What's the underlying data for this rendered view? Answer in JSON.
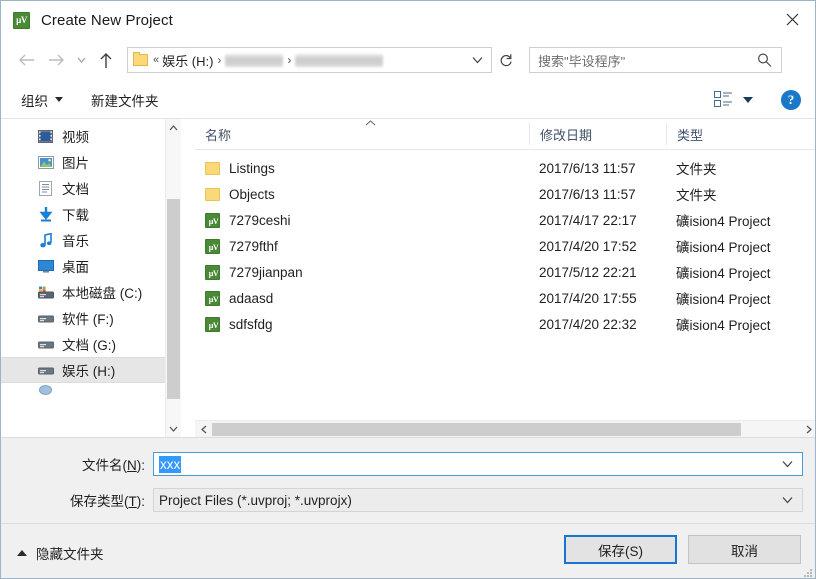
{
  "window": {
    "title": "Create New Project",
    "app_icon": "uvision-icon",
    "close_label": "✕"
  },
  "nav": {
    "back_icon": "arrow-left-icon",
    "forward_icon": "arrow-right-icon",
    "recent_icon": "chevron-down-icon",
    "up_icon": "arrow-up-icon",
    "refresh_icon": "refresh-icon",
    "address": {
      "folder_icon": "folder-icon",
      "overflow": "«",
      "crumbs": [
        {
          "label": "娱乐 (H:)",
          "redacted": false
        },
        {
          "label": "",
          "redacted": true
        },
        {
          "label": "",
          "redacted": true
        }
      ],
      "separator": "›",
      "caret_icon": "chevron-down-icon"
    },
    "search": {
      "placeholder": "搜索\"毕设程序\"",
      "icon": "search-icon"
    }
  },
  "toolbar": {
    "organize_label": "组织",
    "new_folder_label": "新建文件夹",
    "view_icon": "list-view-icon",
    "view_caret_icon": "chevron-down-icon",
    "help_label": "?",
    "help_icon": "help-icon"
  },
  "sidebar": {
    "items": [
      {
        "label": "视频",
        "icon": "videos-icon",
        "selected": false
      },
      {
        "label": "图片",
        "icon": "pictures-icon",
        "selected": false
      },
      {
        "label": "文档",
        "icon": "documents-icon",
        "selected": false
      },
      {
        "label": "下载",
        "icon": "downloads-icon",
        "selected": false
      },
      {
        "label": "音乐",
        "icon": "music-icon",
        "selected": false
      },
      {
        "label": "桌面",
        "icon": "desktop-icon",
        "selected": false
      },
      {
        "label": "本地磁盘 (C:)",
        "icon": "system-drive-icon",
        "selected": false
      },
      {
        "label": "软件 (F:)",
        "icon": "drive-icon",
        "selected": false
      },
      {
        "label": "文档 (G:)",
        "icon": "drive-icon",
        "selected": false
      },
      {
        "label": "娱乐 (H:)",
        "icon": "drive-icon",
        "selected": true
      }
    ],
    "scroll_up_icon": "chevron-up-icon",
    "scroll_down_icon": "chevron-down-icon"
  },
  "filelist": {
    "columns": [
      {
        "key": "name",
        "label": "名称",
        "sorted": "asc"
      },
      {
        "key": "date",
        "label": "修改日期",
        "sorted": ""
      },
      {
        "key": "type",
        "label": "类型",
        "sorted": ""
      }
    ],
    "sort_caret_icon": "sort-ascending-icon",
    "rows": [
      {
        "name": "Listings",
        "date": "2017/6/13 11:57",
        "type": "文件夹",
        "icon": "folder-icon"
      },
      {
        "name": "Objects",
        "date": "2017/6/13 11:57",
        "type": "文件夹",
        "icon": "folder-icon"
      },
      {
        "name": "7279ceshi",
        "date": "2017/4/17 22:17",
        "type": "礦ision4 Project",
        "icon": "uvision-project-icon"
      },
      {
        "name": "7279fthf",
        "date": "2017/4/20 17:52",
        "type": "礦ision4 Project",
        "icon": "uvision-project-icon"
      },
      {
        "name": "7279jianpan",
        "date": "2017/5/12 22:21",
        "type": "礦ision4 Project",
        "icon": "uvision-project-icon"
      },
      {
        "name": "adaasd",
        "date": "2017/4/20 17:55",
        "type": "礦ision4 Project",
        "icon": "uvision-project-icon"
      },
      {
        "name": "sdfsfdg",
        "date": "2017/4/20 22:32",
        "type": "礦ision4 Project",
        "icon": "uvision-project-icon"
      }
    ],
    "hscroll_left_icon": "chevron-left-icon",
    "hscroll_right_icon": "chevron-right-icon"
  },
  "form": {
    "filename_label_pre": "文件名(",
    "filename_label_key": "N",
    "filename_label_post": "):",
    "filename_value": "xxx",
    "filename_caret_icon": "chevron-down-icon",
    "filetype_label_pre": "保存类型(",
    "filetype_label_key": "T",
    "filetype_label_post": "):",
    "filetype_value": "Project Files (*.uvproj; *.uvprojx)",
    "filetype_caret_icon": "chevron-down-icon"
  },
  "footer": {
    "hide_folders_label": "隐藏文件夹",
    "hide_folders_icon": "chevron-up-icon",
    "save_label": "保存(S)",
    "cancel_label": "取消"
  },
  "colors": {
    "accent": "#1876d1",
    "selection": "#3399ff",
    "folder": "#fcd978",
    "uvision_green": "#4a8a36",
    "header_text": "#40516b"
  }
}
